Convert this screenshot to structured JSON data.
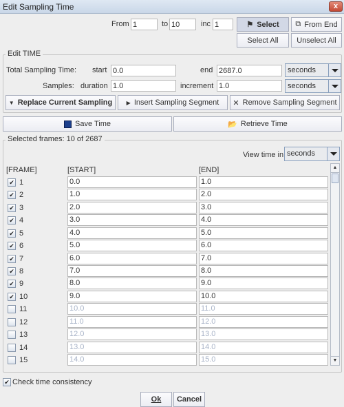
{
  "window": {
    "title": "Edit Sampling Time",
    "close": "x"
  },
  "range": {
    "from_label": "From",
    "from": "1",
    "to_label": "to",
    "to": "10",
    "inc_label": "inc",
    "inc": "1"
  },
  "buttons": {
    "select": "Select",
    "from_end": "From End",
    "select_all": "Select All",
    "unselect_all": "Unselect All",
    "replace": "Replace Current Sampling",
    "insert": "Insert Sampling Segment",
    "remove": "Remove Sampling Segment",
    "save": "Save Time",
    "retrieve": "Retrieve Time",
    "ok": "Ok",
    "cancel": "Cancel"
  },
  "edit_time": {
    "legend": "Edit TIME",
    "total_label": "Total Sampling Time:",
    "start_label": "start",
    "start": "0.0",
    "end_label": "end",
    "end": "2687.0",
    "unit1": "seconds",
    "samples_label": "Samples:",
    "duration_label": "duration",
    "duration": "1.0",
    "increment_label": "increment",
    "increment": "1.0",
    "unit2": "seconds"
  },
  "frames": {
    "legend": "Selected frames: 10 of 2687",
    "view_label": "View time in",
    "view_unit": "seconds",
    "col_frame": "[FRAME]",
    "col_start": "[START]",
    "col_end": "[END]",
    "rows": [
      {
        "n": "1",
        "start": "0.0",
        "end": "1.0",
        "checked": true
      },
      {
        "n": "2",
        "start": "1.0",
        "end": "2.0",
        "checked": true
      },
      {
        "n": "3",
        "start": "2.0",
        "end": "3.0",
        "checked": true
      },
      {
        "n": "4",
        "start": "3.0",
        "end": "4.0",
        "checked": true
      },
      {
        "n": "5",
        "start": "4.0",
        "end": "5.0",
        "checked": true
      },
      {
        "n": "6",
        "start": "5.0",
        "end": "6.0",
        "checked": true
      },
      {
        "n": "7",
        "start": "6.0",
        "end": "7.0",
        "checked": true
      },
      {
        "n": "8",
        "start": "7.0",
        "end": "8.0",
        "checked": true
      },
      {
        "n": "9",
        "start": "8.0",
        "end": "9.0",
        "checked": true
      },
      {
        "n": "10",
        "start": "9.0",
        "end": "10.0",
        "checked": true
      },
      {
        "n": "11",
        "start": "10.0",
        "end": "11.0",
        "checked": false
      },
      {
        "n": "12",
        "start": "11.0",
        "end": "12.0",
        "checked": false
      },
      {
        "n": "13",
        "start": "12.0",
        "end": "13.0",
        "checked": false
      },
      {
        "n": "14",
        "start": "13.0",
        "end": "14.0",
        "checked": false
      },
      {
        "n": "15",
        "start": "14.0",
        "end": "15.0",
        "checked": false
      }
    ]
  },
  "check_consistency": {
    "label": "Check time consistency",
    "checked": true
  }
}
